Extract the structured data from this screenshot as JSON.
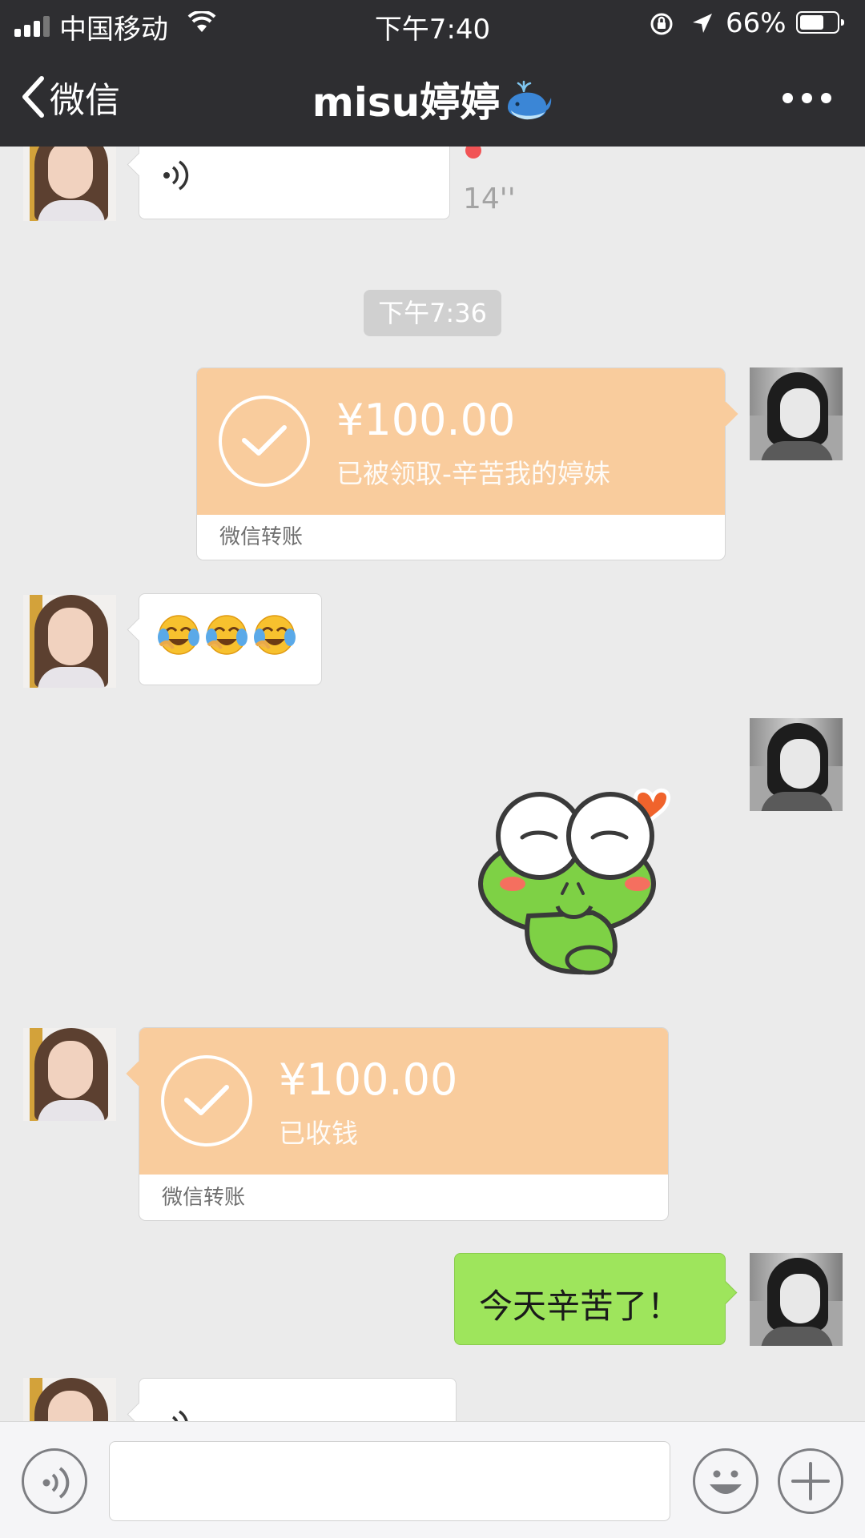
{
  "status_bar": {
    "carrier": "中国移动",
    "time": "下午7:40",
    "battery_percent": "66%",
    "battery_level": 0.66,
    "signal_bars": 3,
    "signal_bars_total": 4
  },
  "nav": {
    "back_label": "微信",
    "title": "misu婷婷",
    "title_emoji": "whale-emoji-icon",
    "more_icon": "more-dots-icon"
  },
  "messages": {
    "voice_1": {
      "duration": "14''",
      "unread": true
    },
    "timestamp_1": "下午7:36",
    "transfer_sent": {
      "amount": "¥100.00",
      "note": "已被领取-辛苦我的婷妹",
      "footer": "微信转账"
    },
    "emoji_msg": {
      "emojis": [
        "face-with-tears-icon",
        "face-with-tears-icon",
        "face-with-tears-icon"
      ]
    },
    "sticker": {
      "icon": "frog-sticker-icon"
    },
    "transfer_received": {
      "amount": "¥100.00",
      "note": "已收钱",
      "footer": "微信转账"
    },
    "text_sent": "今天辛苦了！"
  },
  "input_bar": {
    "voice_icon": "voice-mode-icon",
    "emoji_icon": "emoji-face-icon",
    "plus_icon": "plus-icon",
    "value": ""
  },
  "colors": {
    "nav_bg": "#2e2e31",
    "chat_bg": "#ebebeb",
    "transfer_orange": "#f9cc9d",
    "sent_green": "#9ee55c",
    "unread_red": "#f15355"
  }
}
